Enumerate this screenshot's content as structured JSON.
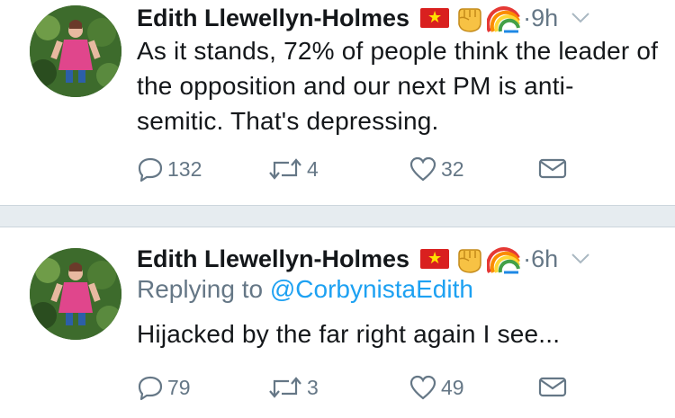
{
  "tweets": [
    {
      "author_name": "Edith Llewellyn-Holmes",
      "time": "9h",
      "separator": "·",
      "text": "As it stands, 72% of people think the leader of the opposition and our next PM is anti-semitic. That's depressing.",
      "replying_label": "",
      "replying_handle": "",
      "replies": "132",
      "retweets": "4",
      "likes": "32"
    },
    {
      "author_name": "Edith Llewellyn-Holmes",
      "time": "6h",
      "separator": "·",
      "text": "Hijacked by the far right again I see...",
      "replying_label": "Replying to",
      "replying_handle": "@CorbynistaEdith",
      "replies": "79",
      "retweets": "3",
      "likes": "49"
    }
  ],
  "emojis": [
    "vietnam-flag-icon",
    "raised-fist-icon",
    "rainbow-icon"
  ],
  "icons": {
    "reply": "reply-icon",
    "retweet": "retweet-icon",
    "like": "heart-icon",
    "dm": "envelope-icon",
    "menu": "chevron-down-icon"
  },
  "colors": {
    "text": "#14171a",
    "secondary": "#657786",
    "link": "#1da1f2",
    "divider": "#e6ecf0"
  }
}
